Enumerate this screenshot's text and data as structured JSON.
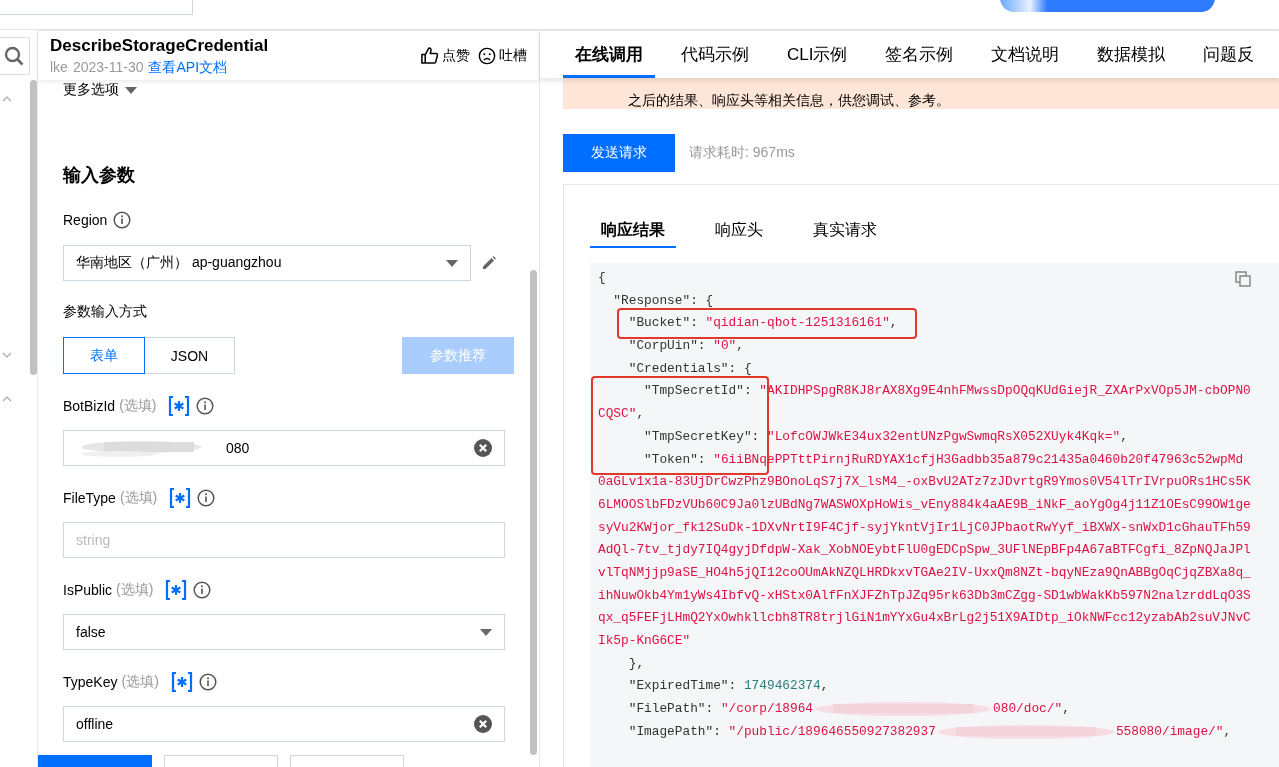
{
  "api_header": {
    "title": "DescribeStorageCredential",
    "product": "lke",
    "date": "2023-11-30",
    "doc_link": "查看API文档",
    "like": "点赞",
    "dislike": "吐槽"
  },
  "more_options": "更多选项",
  "section_title": "输入参数",
  "region": {
    "label": "Region",
    "value": "华南地区（广州） ap-guangzhou"
  },
  "input_mode": {
    "label": "参数输入方式",
    "options": [
      {
        "label": "表单",
        "selected": true
      },
      {
        "label": "JSON",
        "selected": false
      }
    ],
    "recommend_button": {
      "label": "参数推荐",
      "disabled": true
    }
  },
  "params": [
    {
      "name": "BotBizId",
      "optional": "(选填)",
      "kind": "text",
      "value": "080",
      "redacted": true
    },
    {
      "name": "FileType",
      "optional": "(选填)",
      "kind": "text",
      "placeholder": "string"
    },
    {
      "name": "IsPublic",
      "optional": "(选填)",
      "kind": "select",
      "value": "false"
    },
    {
      "name": "TypeKey",
      "optional": "(选填)",
      "kind": "text",
      "value": "offline"
    }
  ],
  "tabs": [
    {
      "label": "在线调用",
      "selected": true
    },
    {
      "label": "代码示例",
      "selected": false
    },
    {
      "label": "CLI示例",
      "selected": false
    },
    {
      "label": "签名示例",
      "selected": false
    },
    {
      "label": "文档说明",
      "selected": false
    },
    {
      "label": "数据模拟",
      "selected": false
    },
    {
      "label": "问题反",
      "selected": false
    }
  ],
  "notice": "之后的结果、响应头等相关信息，供您调试、参考。",
  "send_button": "发送请求",
  "elapsed": "请求耗时: 967ms",
  "response_tabs": [
    {
      "label": "响应结果",
      "selected": true
    },
    {
      "label": "响应头",
      "selected": false
    },
    {
      "label": "真实请求",
      "selected": false
    }
  ],
  "code_lines": [
    {
      "boxed": false,
      "segments": [
        {
          "kind": "punct",
          "text": "{"
        }
      ]
    },
    {
      "boxed": false,
      "segments": [
        {
          "kind": "key",
          "text": "  \"Response\""
        },
        {
          "kind": "punct",
          "text": ": {"
        }
      ]
    },
    {
      "boxed": true,
      "segments": [
        {
          "kind": "key",
          "text": "    \"Bucket\""
        },
        {
          "kind": "punct",
          "text": ": "
        },
        {
          "kind": "string",
          "text": "\"qidian-qbot-1251316161\""
        },
        {
          "kind": "punct",
          "text": ","
        }
      ]
    },
    {
      "boxed": false,
      "segments": [
        {
          "kind": "key",
          "text": "    \"CorpUin\""
        },
        {
          "kind": "punct",
          "text": ": "
        },
        {
          "kind": "string",
          "text": "\"0\""
        },
        {
          "kind": "punct",
          "text": ","
        }
      ]
    },
    {
      "boxed": false,
      "segments": [
        {
          "kind": "key",
          "text": "    \"Credentials\""
        },
        {
          "kind": "punct",
          "text": ": {"
        }
      ]
    },
    {
      "boxed": true,
      "segments": [
        {
          "kind": "key",
          "text": "      \"TmpSecretId\""
        },
        {
          "kind": "punct",
          "text": ": "
        },
        {
          "kind": "string",
          "text": "\"AKIDHPSpgR8KJ8rAX8Xg9E4nhFMwssDpOQqKUdGiejR_ZXArPxVOp5JM-cbOPN0"
        }
      ]
    },
    {
      "boxed": true,
      "segments": [
        {
          "kind": "string",
          "text": "CQSC\""
        },
        {
          "kind": "punct",
          "text": ","
        }
      ]
    },
    {
      "boxed": true,
      "segments": [
        {
          "kind": "key",
          "text": "      \"TmpSecretKey\""
        },
        {
          "kind": "punct",
          "text": ": "
        },
        {
          "kind": "string",
          "text": "\"LofcOWJWkE34ux32entUNzPgwSwmqRsX052XUyk4Kqk=\""
        },
        {
          "kind": "punct",
          "text": ","
        }
      ]
    },
    {
      "boxed": true,
      "segments": [
        {
          "kind": "key",
          "text": "      \"Token\""
        },
        {
          "kind": "punct",
          "text": ": "
        },
        {
          "kind": "string",
          "text": "\"6iiBNqePPTttPirnjRuRDYAX1cfjH3Gadbb35a879c21435a0460b20f47963c52wpMd"
        }
      ]
    },
    {
      "boxed": false,
      "segments": [
        {
          "kind": "string",
          "text": "0aGLv1x1a-83UjDrCwzPhz9BOnoLqS7j7X_lsM4_-oxBvU2ATz7zJDvrtgR9Ymos0V54lTrIVrpuORs1HCs5K"
        }
      ]
    },
    {
      "boxed": false,
      "segments": [
        {
          "kind": "string",
          "text": "6LMOOSlbFDzVUb60C9Ja0lzUBdNg7WASWOXpHoWis_vEny884k4aAE9B_iNkF_aoYgOg4j11Z1OEsC99OW1ge"
        }
      ]
    },
    {
      "boxed": false,
      "segments": [
        {
          "kind": "string",
          "text": "syVu2KWjor_fk12SuDk-1DXvNrtI9F4Cjf-syjYkntVjIr1LjC0JPbaotRwYyf_iBXWX-snWxD1cGhauTFh59"
        }
      ]
    },
    {
      "boxed": false,
      "segments": [
        {
          "kind": "string",
          "text": "AdQl-7tv_tjdy7IQ4gyjDfdpW-Xak_XobNOEybtFlU0gEDCpSpw_3UFlNEpBFp4A67aBTFCgfi_8ZpNQJaJPl"
        }
      ]
    },
    {
      "boxed": false,
      "segments": [
        {
          "kind": "string",
          "text": "vlTqNMjjp9aSE_HO4h5jQI12coOUmAkNZQLHRDkxvTGAe2IV-UxxQm8NZt-bqyNEza9QnABBgOqCjqZBXa8q_"
        }
      ]
    },
    {
      "boxed": false,
      "segments": [
        {
          "kind": "string",
          "text": "ihNuwOkb4Ym1yWs4IbfvQ-xHStx0AlfFnXJFZhTpJZq95rk63Db3mCZgg-SD1wbWakKb597N2nalzrddLqO3S"
        }
      ]
    },
    {
      "boxed": false,
      "segments": [
        {
          "kind": "string",
          "text": "qx_q5FEFjLHmQ2YxOwhkllcbh8TR8trjlGiN1mYYxGu4xBrLg2j51X9AIDtp_iOkNWFcc12yzabAb2suVJNvC"
        }
      ]
    },
    {
      "boxed": false,
      "segments": [
        {
          "kind": "string",
          "text": "Ik5p-KnG6CE\""
        }
      ]
    },
    {
      "boxed": false,
      "segments": [
        {
          "kind": "punct",
          "text": "    },"
        }
      ]
    },
    {
      "boxed": false,
      "segments": [
        {
          "kind": "key",
          "text": "    \"ExpiredTime\""
        },
        {
          "kind": "punct",
          "text": ": "
        },
        {
          "kind": "number",
          "text": "1749462374"
        },
        {
          "kind": "punct",
          "text": ","
        }
      ]
    },
    {
      "boxed": false,
      "segments": [
        {
          "kind": "key",
          "text": "    \"FilePath\""
        },
        {
          "kind": "punct",
          "text": ": "
        },
        {
          "kind": "string",
          "text": "\"/corp/18964"
        },
        {
          "kind": "redacted"
        },
        {
          "kind": "string",
          "text": "080/doc/\""
        },
        {
          "kind": "punct",
          "text": ","
        }
      ]
    },
    {
      "boxed": false,
      "segments": [
        {
          "kind": "key",
          "text": "    \"ImagePath\""
        },
        {
          "kind": "punct",
          "text": ": "
        },
        {
          "kind": "string",
          "text": "\"/public/189646550927382937"
        },
        {
          "kind": "redacted"
        },
        {
          "kind": "string",
          "text": "558080/image/\""
        },
        {
          "kind": "punct",
          "text": ","
        }
      ]
    }
  ]
}
